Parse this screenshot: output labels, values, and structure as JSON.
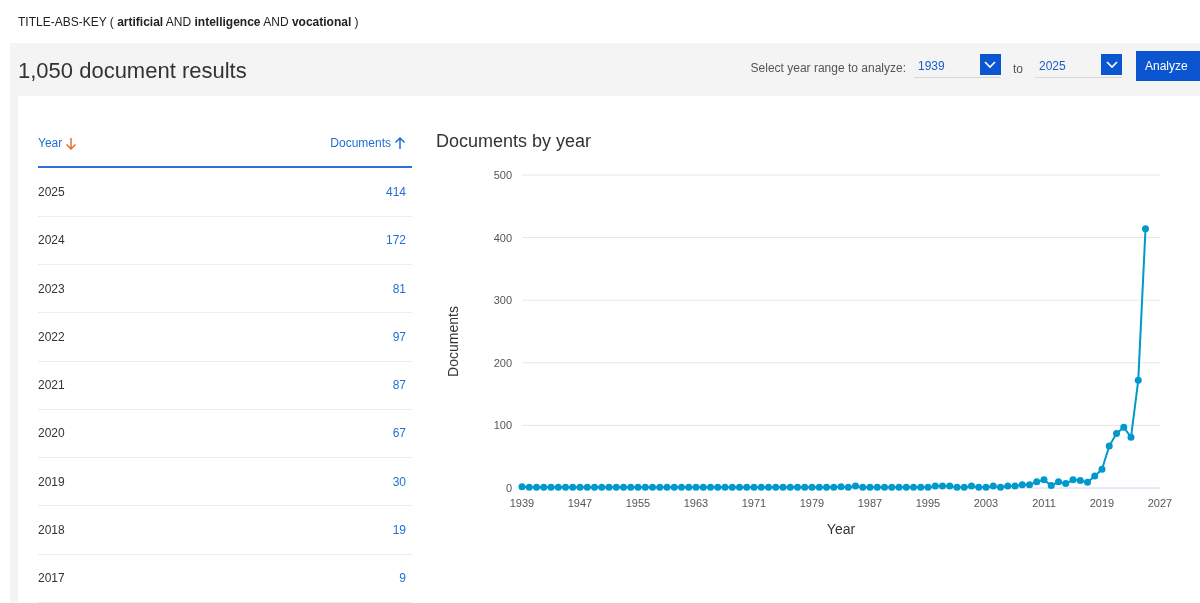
{
  "query": "TITLE-ABS-KEY ( **artificial**  AND **intelligence**  AND **vocational** )",
  "results_title": "1,050 document results",
  "year_range": {
    "label": "Select year range to analyze:",
    "from": "1939",
    "separator": "to",
    "to": "2025",
    "button": "Analyze"
  },
  "table": {
    "columns": [
      {
        "label": "Year",
        "descending": true,
        "active": true
      },
      {
        "label": "Documents",
        "descending": false,
        "active": false
      }
    ],
    "rows": [
      {
        "year": "2025",
        "documents": "414"
      },
      {
        "year": "2024",
        "documents": "172"
      },
      {
        "year": "2023",
        "documents": "81"
      },
      {
        "year": "2022",
        "documents": "97"
      },
      {
        "year": "2021",
        "documents": "87"
      },
      {
        "year": "2020",
        "documents": "67"
      },
      {
        "year": "2019",
        "documents": "30"
      },
      {
        "year": "2018",
        "documents": "19"
      },
      {
        "year": "2017",
        "documents": "9"
      }
    ]
  },
  "chart": {
    "title": "Documents by year",
    "chart_data": {
      "type": "line",
      "xlabel": "Year",
      "ylabel": "Documents",
      "x": [
        1939,
        1940,
        1941,
        1942,
        1943,
        1944,
        1945,
        1946,
        1947,
        1948,
        1949,
        1950,
        1951,
        1952,
        1953,
        1954,
        1955,
        1956,
        1957,
        1958,
        1959,
        1960,
        1961,
        1962,
        1963,
        1964,
        1965,
        1966,
        1967,
        1968,
        1969,
        1970,
        1971,
        1972,
        1973,
        1974,
        1975,
        1976,
        1977,
        1978,
        1979,
        1980,
        1981,
        1982,
        1983,
        1984,
        1985,
        1986,
        1987,
        1988,
        1989,
        1990,
        1991,
        1992,
        1993,
        1994,
        1995,
        1996,
        1997,
        1998,
        1999,
        2000,
        2001,
        2002,
        2003,
        2004,
        2005,
        2006,
        2007,
        2008,
        2009,
        2010,
        2011,
        2012,
        2013,
        2014,
        2015,
        2016,
        2017,
        2018,
        2019,
        2020,
        2021,
        2022,
        2023,
        2024,
        2025
      ],
      "grid": true,
      "series": [
        {
          "color": "#0099cc",
          "marker": true,
          "values": [
            2,
            1,
            1,
            1,
            1,
            1,
            1,
            1,
            1,
            1,
            1,
            1,
            1,
            1,
            1,
            1,
            1,
            1,
            1,
            1,
            1,
            1,
            1,
            1,
            1,
            1,
            1,
            1,
            1,
            1,
            1,
            1,
            1,
            1,
            1,
            1,
            1,
            1,
            1,
            1,
            1,
            1,
            1,
            1,
            2,
            1,
            3,
            1,
            1,
            1,
            1,
            1,
            1,
            1,
            1,
            1,
            1,
            3,
            3,
            3,
            1,
            1,
            3,
            1,
            1,
            3,
            1,
            3,
            3,
            5,
            5,
            10,
            13,
            4,
            10,
            7,
            13,
            12,
            9,
            19,
            30,
            67,
            87,
            97,
            81,
            172,
            414
          ]
        }
      ],
      "xlim": [
        1939,
        2027
      ],
      "ylim": [
        0,
        500
      ],
      "xticks": [
        1939,
        1947,
        1955,
        1963,
        1971,
        1979,
        1987,
        1995,
        2003,
        2011,
        2019,
        2027
      ],
      "yticks": [
        0,
        100,
        200,
        300,
        400,
        500
      ]
    }
  }
}
